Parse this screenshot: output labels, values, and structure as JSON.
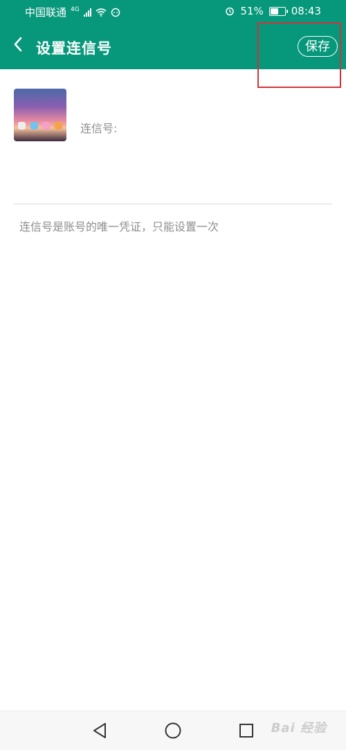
{
  "status_bar": {
    "carrier": "中国联通",
    "network": "4G",
    "battery": "51%",
    "battery_fraction": 0.51,
    "time": "08:43"
  },
  "header": {
    "title": "设置连信号",
    "save_label": "保存"
  },
  "profile": {
    "id_label": "连信号:"
  },
  "input": {
    "value": "",
    "placeholder": ""
  },
  "hint": "连信号是账号的唯一凭证，只能设置一次",
  "watermark": "Bai 经验",
  "colors": {
    "primary": "#07977b",
    "highlight": "#d1323a",
    "secondary_text": "#8e8e8e"
  },
  "icons": {
    "back": "chevron-left-icon",
    "alarm": "alarm-icon",
    "wifi": "wifi-icon",
    "nav_back": "triangle-back-icon",
    "nav_home": "circle-home-icon",
    "nav_recent": "square-recent-icon"
  }
}
